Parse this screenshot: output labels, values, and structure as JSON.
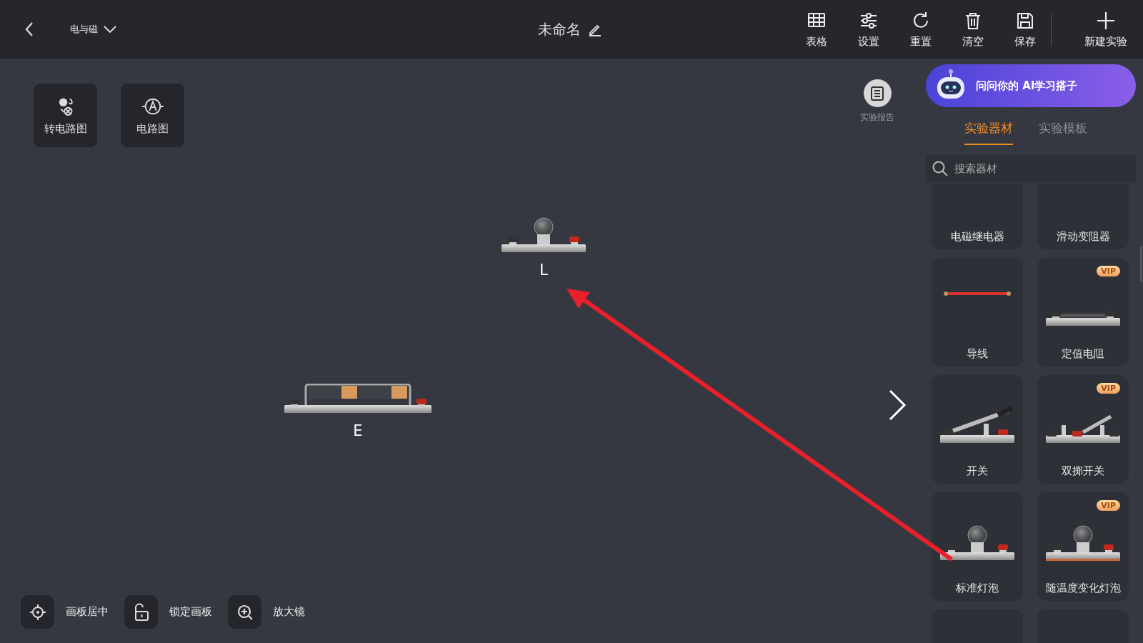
{
  "topbar": {
    "subject": "电与磁",
    "title": "未命名",
    "actions": [
      {
        "kind": "table",
        "label": "表格"
      },
      {
        "kind": "settings",
        "label": "设置"
      },
      {
        "kind": "reset",
        "label": "重置"
      },
      {
        "kind": "clear",
        "label": "清空"
      },
      {
        "kind": "save",
        "label": "保存"
      },
      {
        "kind": "new",
        "label": "新建实验"
      }
    ]
  },
  "canvas": {
    "tools": [
      {
        "kind": "convert",
        "label": "转电路图"
      },
      {
        "kind": "circuit",
        "label": "电路图"
      }
    ],
    "report": "实验报告",
    "items": [
      {
        "kind": "bulb",
        "label": "L"
      },
      {
        "kind": "battery",
        "label": "E"
      }
    ],
    "bottom_tools": [
      {
        "kind": "center",
        "label": "画板居中"
      },
      {
        "kind": "lock",
        "label": "锁定画板"
      },
      {
        "kind": "magnifier",
        "label": "放大镜"
      }
    ]
  },
  "panel": {
    "ai_banner": "问问你的 AI学习搭子",
    "tabs": [
      {
        "label": "实验器材",
        "selected": true
      },
      {
        "label": "实验模板",
        "selected": false
      }
    ],
    "search": {
      "placeholder": "搜索器材"
    },
    "components": [
      {
        "kind": "relay",
        "label": "电磁继电器",
        "vip": false
      },
      {
        "kind": "rheostat",
        "label": "滑动变阻器",
        "vip": false
      },
      {
        "kind": "wire",
        "label": "导线",
        "vip": false
      },
      {
        "kind": "resistor",
        "label": "定值电阻",
        "vip": true,
        "badge": "VIP"
      },
      {
        "kind": "switch",
        "label": "开关",
        "vip": false
      },
      {
        "kind": "double-switch",
        "label": "双掷开关",
        "vip": true,
        "badge": "VIP"
      },
      {
        "kind": "bulb",
        "label": "标准灯泡",
        "vip": false
      },
      {
        "kind": "thermal-bulb",
        "label": "随温度变化灯泡",
        "vip": true,
        "badge": "VIP"
      },
      {
        "kind": "rod",
        "vip": false
      },
      {
        "kind": "blank",
        "vip": false
      }
    ]
  }
}
